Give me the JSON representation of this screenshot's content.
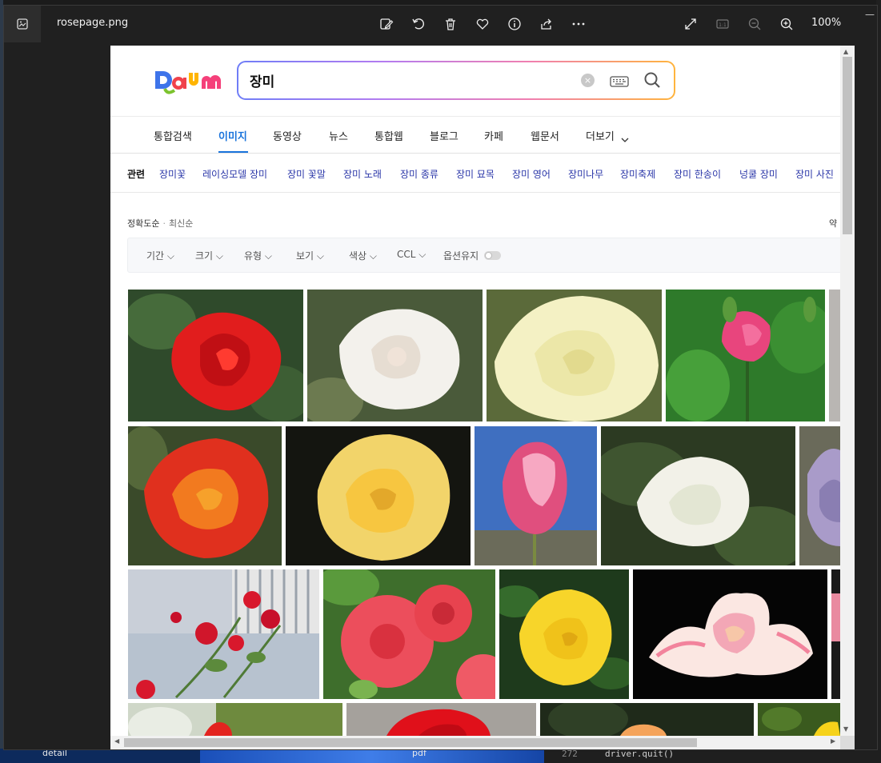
{
  "viewer": {
    "filename": "rosepage.png",
    "zoom": "100%",
    "toolbar": [
      "edit-icon",
      "rotate-icon",
      "delete-icon",
      "favorite-icon",
      "info-icon",
      "share-icon",
      "more-icon",
      "fullscreen-icon",
      "actual-size-icon",
      "zoom-out-icon",
      "zoom-in-icon"
    ],
    "minimize_label": "—"
  },
  "desktop": {
    "taskbar_labels": [
      "detail",
      "pdf"
    ],
    "code_line_number": "272",
    "code_line": "driver.quit()"
  },
  "page": {
    "logo": "Daum",
    "search": {
      "query": "장미",
      "clear_label": "×"
    },
    "tabs": [
      {
        "label": "통합검색",
        "active": false
      },
      {
        "label": "이미지",
        "active": true
      },
      {
        "label": "동영상",
        "active": false
      },
      {
        "label": "뉴스",
        "active": false
      },
      {
        "label": "통합웹",
        "active": false
      },
      {
        "label": "블로그",
        "active": false
      },
      {
        "label": "카페",
        "active": false
      },
      {
        "label": "웹문서",
        "active": false
      },
      {
        "label": "더보기",
        "active": false
      }
    ],
    "related": {
      "title": "관련",
      "keywords": [
        "장미꽃",
        "레이싱모델 장미",
        "장미 꽃말",
        "장미 노래",
        "장미 종류",
        "장미 묘목",
        "장미 영어",
        "장미나무",
        "장미축제",
        "장미 한송이",
        "넝쿨 장미",
        "장미 사진"
      ]
    },
    "sort": {
      "accuracy": "정확도순",
      "latest": "최신순",
      "right_text": "약"
    },
    "filters": [
      "기간",
      "크기",
      "유형",
      "보기",
      "색상",
      "CCL"
    ],
    "option_keep": "옵션유지",
    "colors": {
      "accent": "#1a74dc",
      "related_link": "#2a36a8"
    },
    "images": [
      "red-rose",
      "white-rose",
      "cream-rose",
      "pink-rosebud",
      "gray-edge",
      "orange-red-rose",
      "yellow-rose",
      "pink-tulip-rose",
      "white-rose-bush",
      "lavender-rose",
      "red-climbing-roses",
      "coral-roses",
      "yellow-rose-leaves",
      "pink-white-rose",
      "pink-edge",
      "blurred-red-rose",
      "red-rose-bottom",
      "orange-rose-bottom",
      "yellow-rose-bottom"
    ]
  }
}
